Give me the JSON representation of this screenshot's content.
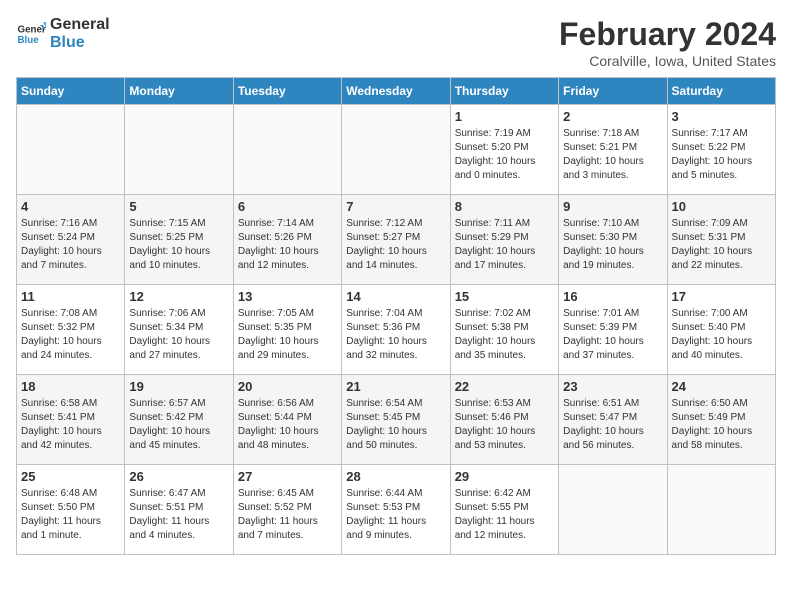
{
  "header": {
    "logo_line1": "General",
    "logo_line2": "Blue",
    "title": "February 2024",
    "subtitle": "Coralville, Iowa, United States"
  },
  "columns": [
    "Sunday",
    "Monday",
    "Tuesday",
    "Wednesday",
    "Thursday",
    "Friday",
    "Saturday"
  ],
  "weeks": [
    [
      {
        "day": "",
        "info": ""
      },
      {
        "day": "",
        "info": ""
      },
      {
        "day": "",
        "info": ""
      },
      {
        "day": "",
        "info": ""
      },
      {
        "day": "1",
        "info": "Sunrise: 7:19 AM\nSunset: 5:20 PM\nDaylight: 10 hours\nand 0 minutes."
      },
      {
        "day": "2",
        "info": "Sunrise: 7:18 AM\nSunset: 5:21 PM\nDaylight: 10 hours\nand 3 minutes."
      },
      {
        "day": "3",
        "info": "Sunrise: 7:17 AM\nSunset: 5:22 PM\nDaylight: 10 hours\nand 5 minutes."
      }
    ],
    [
      {
        "day": "4",
        "info": "Sunrise: 7:16 AM\nSunset: 5:24 PM\nDaylight: 10 hours\nand 7 minutes."
      },
      {
        "day": "5",
        "info": "Sunrise: 7:15 AM\nSunset: 5:25 PM\nDaylight: 10 hours\nand 10 minutes."
      },
      {
        "day": "6",
        "info": "Sunrise: 7:14 AM\nSunset: 5:26 PM\nDaylight: 10 hours\nand 12 minutes."
      },
      {
        "day": "7",
        "info": "Sunrise: 7:12 AM\nSunset: 5:27 PM\nDaylight: 10 hours\nand 14 minutes."
      },
      {
        "day": "8",
        "info": "Sunrise: 7:11 AM\nSunset: 5:29 PM\nDaylight: 10 hours\nand 17 minutes."
      },
      {
        "day": "9",
        "info": "Sunrise: 7:10 AM\nSunset: 5:30 PM\nDaylight: 10 hours\nand 19 minutes."
      },
      {
        "day": "10",
        "info": "Sunrise: 7:09 AM\nSunset: 5:31 PM\nDaylight: 10 hours\nand 22 minutes."
      }
    ],
    [
      {
        "day": "11",
        "info": "Sunrise: 7:08 AM\nSunset: 5:32 PM\nDaylight: 10 hours\nand 24 minutes."
      },
      {
        "day": "12",
        "info": "Sunrise: 7:06 AM\nSunset: 5:34 PM\nDaylight: 10 hours\nand 27 minutes."
      },
      {
        "day": "13",
        "info": "Sunrise: 7:05 AM\nSunset: 5:35 PM\nDaylight: 10 hours\nand 29 minutes."
      },
      {
        "day": "14",
        "info": "Sunrise: 7:04 AM\nSunset: 5:36 PM\nDaylight: 10 hours\nand 32 minutes."
      },
      {
        "day": "15",
        "info": "Sunrise: 7:02 AM\nSunset: 5:38 PM\nDaylight: 10 hours\nand 35 minutes."
      },
      {
        "day": "16",
        "info": "Sunrise: 7:01 AM\nSunset: 5:39 PM\nDaylight: 10 hours\nand 37 minutes."
      },
      {
        "day": "17",
        "info": "Sunrise: 7:00 AM\nSunset: 5:40 PM\nDaylight: 10 hours\nand 40 minutes."
      }
    ],
    [
      {
        "day": "18",
        "info": "Sunrise: 6:58 AM\nSunset: 5:41 PM\nDaylight: 10 hours\nand 42 minutes."
      },
      {
        "day": "19",
        "info": "Sunrise: 6:57 AM\nSunset: 5:42 PM\nDaylight: 10 hours\nand 45 minutes."
      },
      {
        "day": "20",
        "info": "Sunrise: 6:56 AM\nSunset: 5:44 PM\nDaylight: 10 hours\nand 48 minutes."
      },
      {
        "day": "21",
        "info": "Sunrise: 6:54 AM\nSunset: 5:45 PM\nDaylight: 10 hours\nand 50 minutes."
      },
      {
        "day": "22",
        "info": "Sunrise: 6:53 AM\nSunset: 5:46 PM\nDaylight: 10 hours\nand 53 minutes."
      },
      {
        "day": "23",
        "info": "Sunrise: 6:51 AM\nSunset: 5:47 PM\nDaylight: 10 hours\nand 56 minutes."
      },
      {
        "day": "24",
        "info": "Sunrise: 6:50 AM\nSunset: 5:49 PM\nDaylight: 10 hours\nand 58 minutes."
      }
    ],
    [
      {
        "day": "25",
        "info": "Sunrise: 6:48 AM\nSunset: 5:50 PM\nDaylight: 11 hours\nand 1 minute."
      },
      {
        "day": "26",
        "info": "Sunrise: 6:47 AM\nSunset: 5:51 PM\nDaylight: 11 hours\nand 4 minutes."
      },
      {
        "day": "27",
        "info": "Sunrise: 6:45 AM\nSunset: 5:52 PM\nDaylight: 11 hours\nand 7 minutes."
      },
      {
        "day": "28",
        "info": "Sunrise: 6:44 AM\nSunset: 5:53 PM\nDaylight: 11 hours\nand 9 minutes."
      },
      {
        "day": "29",
        "info": "Sunrise: 6:42 AM\nSunset: 5:55 PM\nDaylight: 11 hours\nand 12 minutes."
      },
      {
        "day": "",
        "info": ""
      },
      {
        "day": "",
        "info": ""
      }
    ]
  ]
}
